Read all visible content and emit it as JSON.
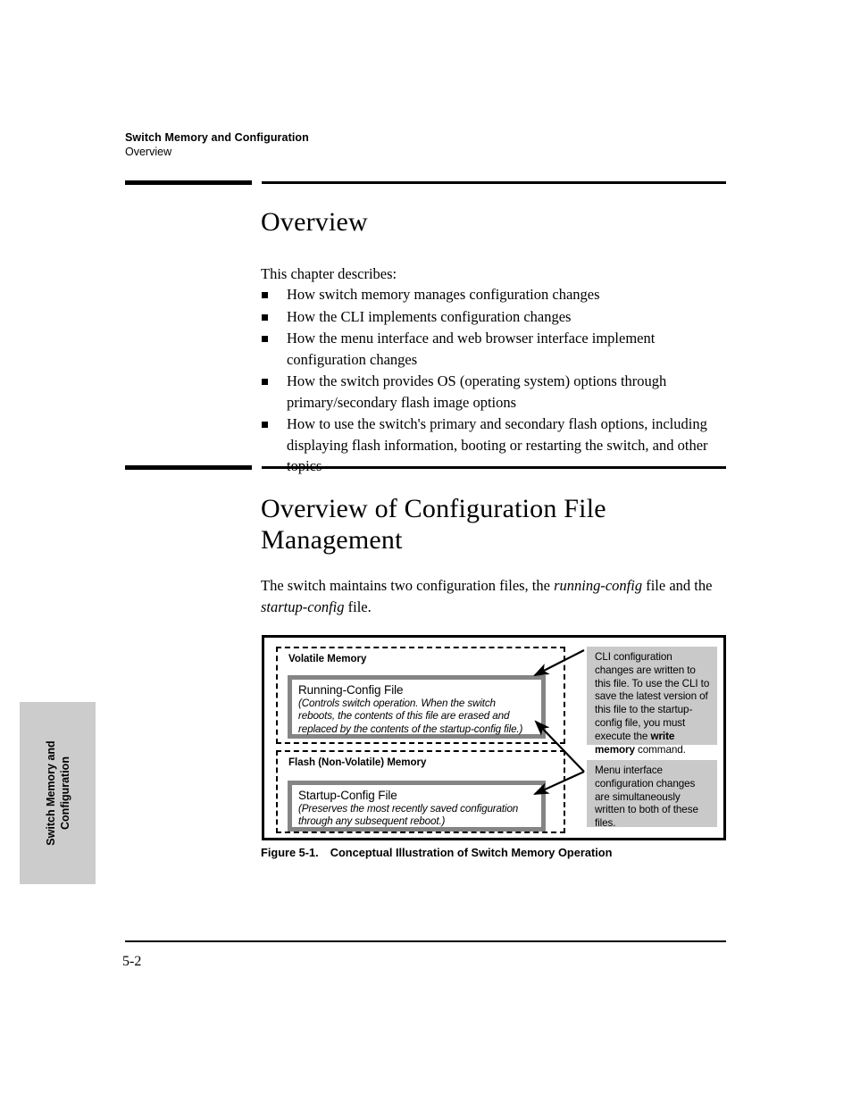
{
  "running_header": {
    "chapter_title": "Switch Memory and Configuration",
    "section": "Overview"
  },
  "chapter_tab": {
    "line1": "Switch Memory and",
    "line2": "Configuration",
    "background_color": "#cccccc"
  },
  "sections": {
    "overview": {
      "heading": "Overview",
      "intro": "This chapter describes:",
      "bullets": [
        "How switch memory manages configuration changes",
        "How the CLI implements configuration changes",
        "How the menu interface and web browser interface implement configuration changes",
        "How the switch provides OS (operating system) options through primary/secondary flash image options",
        "How to use the switch's primary and secondary flash options, including displaying flash information, booting or restarting the switch, and other topics"
      ]
    },
    "config_file_management": {
      "heading_line1": "Overview of Configuration File",
      "heading_line2": "Management",
      "paragraph_part1": "The switch maintains two configuration files, the ",
      "paragraph_italic1": "running-config",
      "paragraph_part2": " file and the ",
      "paragraph_italic2": "startup-config",
      "paragraph_part3": " file."
    }
  },
  "figure": {
    "caption_label": "Figure 5-1.",
    "caption_text": "Conceptual Illustration of Switch Memory Operation",
    "regions": [
      {
        "title": "Volatile Memory",
        "file_title": "Running-Config File",
        "file_desc": "(Controls switch operation. When the switch reboots, the contents of this file are erased and replaced by the contents of the startup-config file.)"
      },
      {
        "title": "Flash (Non-Volatile) Memory",
        "file_title": "Startup-Config File",
        "file_desc": "(Preserves the most recently saved configuration through any subsequent reboot.)"
      }
    ],
    "callouts": [
      {
        "text_part1": "CLI configuration changes are written to this file.  To use the CLI to save the latest version of this file to the startup-config file, you must execute the ",
        "text_bold": "write memory",
        "text_part2": " command."
      },
      {
        "text": "Menu interface  configuration changes are simultaneously written to both of these files."
      }
    ],
    "colors": {
      "callout_background": "#c9c9c9",
      "file_box_border": "#858585",
      "region_border": "#000000"
    }
  },
  "footer": {
    "page_number": "5-2"
  }
}
